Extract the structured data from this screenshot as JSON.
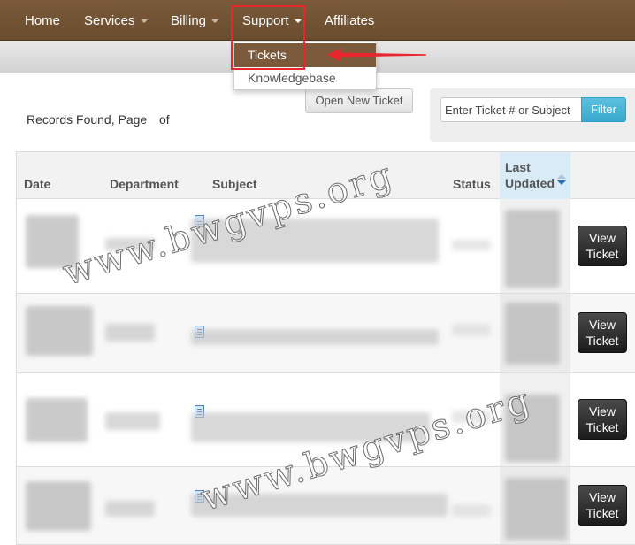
{
  "nav": {
    "home": "Home",
    "services": "Services",
    "billing": "Billing",
    "support": "Support",
    "affiliates": "Affiliates"
  },
  "dropdown": {
    "tickets": "Tickets",
    "knowledgebase": "Knowledgebase"
  },
  "toolbar": {
    "records_text": "Records Found, Page",
    "of_text": "of",
    "open_ticket_label": "Open New Ticket",
    "search_placeholder": "Enter Ticket # or Subject",
    "filter_label": "Filter"
  },
  "table": {
    "headers": {
      "date": "Date",
      "department": "Department",
      "subject": "Subject",
      "status": "Status",
      "last_updated_line1": "Last",
      "last_updated_line2": "Updated"
    },
    "rows": [
      {
        "view_label_1": "View",
        "view_label_2": "Ticket"
      },
      {
        "view_label_1": "View",
        "view_label_2": "Ticket"
      },
      {
        "view_label_1": "View",
        "view_label_2": "Ticket"
      },
      {
        "view_label_1": "View",
        "view_label_2": "Ticket"
      }
    ]
  },
  "watermark": {
    "text": "www.bwgvps.org"
  },
  "colors": {
    "nav_bg": "#6f4f31",
    "filter_button": "#46b8da",
    "view_button": "#2a2a2a",
    "highlight": "#e8262d"
  }
}
